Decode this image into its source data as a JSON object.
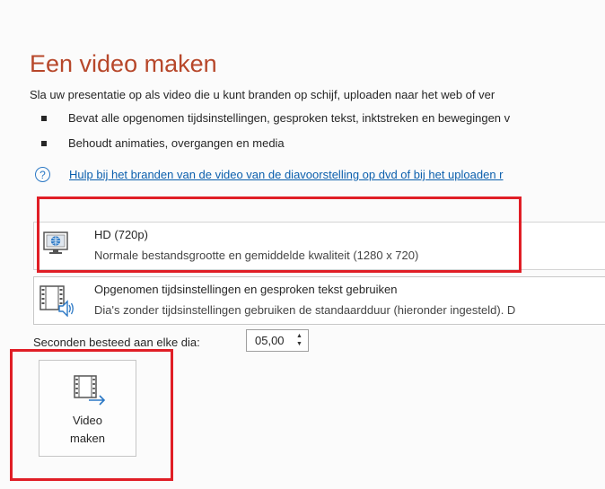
{
  "page": {
    "title": "Een video maken",
    "description": "Sla uw presentatie op als video die u kunt branden op schijf, uploaden naar het web of ver",
    "bullets": [
      "Bevat alle opgenomen tijdsinstellingen, gesproken tekst, inktstreken en bewegingen v",
      "Behoudt animaties, overgangen en media"
    ],
    "help_link": "Hulp bij het branden van de video van de diavoorstelling op dvd of bij het uploaden r",
    "help_icon_glyph": "?"
  },
  "quality_dropdown": {
    "icon": "monitor-icon",
    "title": "HD (720p)",
    "subtitle": "Normale bestandsgrootte en gemiddelde kwaliteit (1280 x 720)"
  },
  "timing_dropdown": {
    "icon": "film-sound-icon",
    "title": "Opgenomen tijdsinstellingen en gesproken tekst gebruiken",
    "subtitle": "Dia's zonder tijdsinstellingen gebruiken de standaardduur (hieronder ingesteld). D"
  },
  "seconds": {
    "label": "Seconden besteed aan elke dia:",
    "value": "05,00"
  },
  "create_button": {
    "icon": "create-video-icon",
    "label_line1": "Video",
    "label_line2": "maken"
  },
  "colors": {
    "title": "#b7472a",
    "link": "#0b5fad",
    "highlight": "#e01e26"
  }
}
